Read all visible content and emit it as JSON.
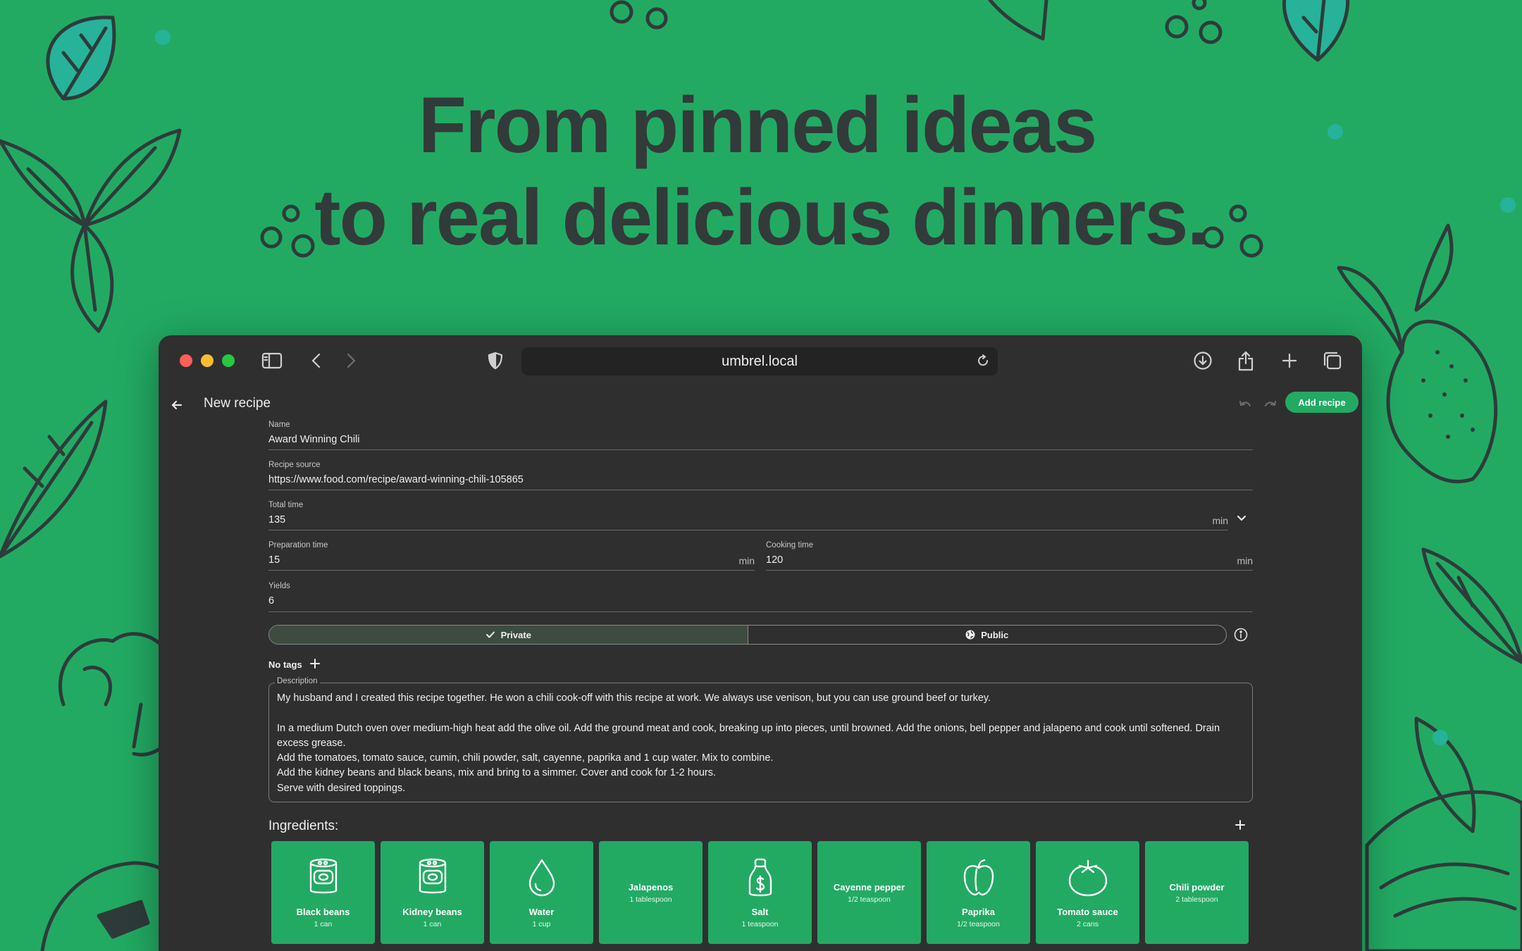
{
  "hero": {
    "line1": "From pinned ideas",
    "line2": "to real delicious dinners."
  },
  "browser": {
    "url": "umbrel.local"
  },
  "app": {
    "page_title": "New recipe",
    "add_button_label": "Add recipe"
  },
  "form": {
    "name": {
      "label": "Name",
      "value": "Award Winning Chili"
    },
    "source": {
      "label": "Recipe source",
      "value": "https://www.food.com/recipe/award-winning-chili-105865"
    },
    "total_time": {
      "label": "Total time",
      "value": "135",
      "unit": "min"
    },
    "prep_time": {
      "label": "Preparation time",
      "value": "15",
      "unit": "min"
    },
    "cook_time": {
      "label": "Cooking time",
      "value": "120",
      "unit": "min"
    },
    "yields": {
      "label": "Yields",
      "value": "6"
    },
    "visibility": {
      "private_label": "Private",
      "public_label": "Public",
      "selected": "Private"
    },
    "tags_label": "No tags",
    "description": {
      "label": "Description",
      "text": "My husband and I created this recipe together. He won a chili cook-off with this recipe at work. We always use venison, but you can use ground beef or turkey.\n\nIn a medium Dutch oven over medium-high heat add the olive oil. Add the ground meat and cook, breaking up into pieces, until browned. Add the onions, bell pepper and jalapeno and cook until softened. Drain excess grease.\nAdd the tomatoes, tomato sauce, cumin, chili powder, salt, cayenne, paprika and 1 cup water. Mix to combine.\nAdd the kidney beans and black beans, mix and bring to a simmer. Cover and cook for 1-2 hours.\nServe with desired toppings."
    }
  },
  "ingredients": {
    "title": "Ingredients:",
    "items": [
      {
        "name": "Black beans",
        "amount": "1 can",
        "icon": "can-icon"
      },
      {
        "name": "Kidney beans",
        "amount": "1 can",
        "icon": "can-icon"
      },
      {
        "name": "Water",
        "amount": "1 cup",
        "icon": "water-drop-icon"
      },
      {
        "name": "Jalapenos",
        "amount": "1 tablespoon",
        "icon": ""
      },
      {
        "name": "Salt",
        "amount": "1 teaspoon",
        "icon": "salt-shaker-icon"
      },
      {
        "name": "Cayenne pepper",
        "amount": "1/2 teaspoon",
        "icon": ""
      },
      {
        "name": "Paprika",
        "amount": "1/2 teaspoon",
        "icon": "bell-pepper-icon"
      },
      {
        "name": "Tomato sauce",
        "amount": "2 cans",
        "icon": "tomato-icon"
      },
      {
        "name": "Chili powder",
        "amount": "2 tablespoon",
        "icon": ""
      }
    ]
  },
  "colors": {
    "background": "#22aa63",
    "window": "#2f2f30",
    "accent": "#22aa63",
    "headline": "#333a3a"
  }
}
